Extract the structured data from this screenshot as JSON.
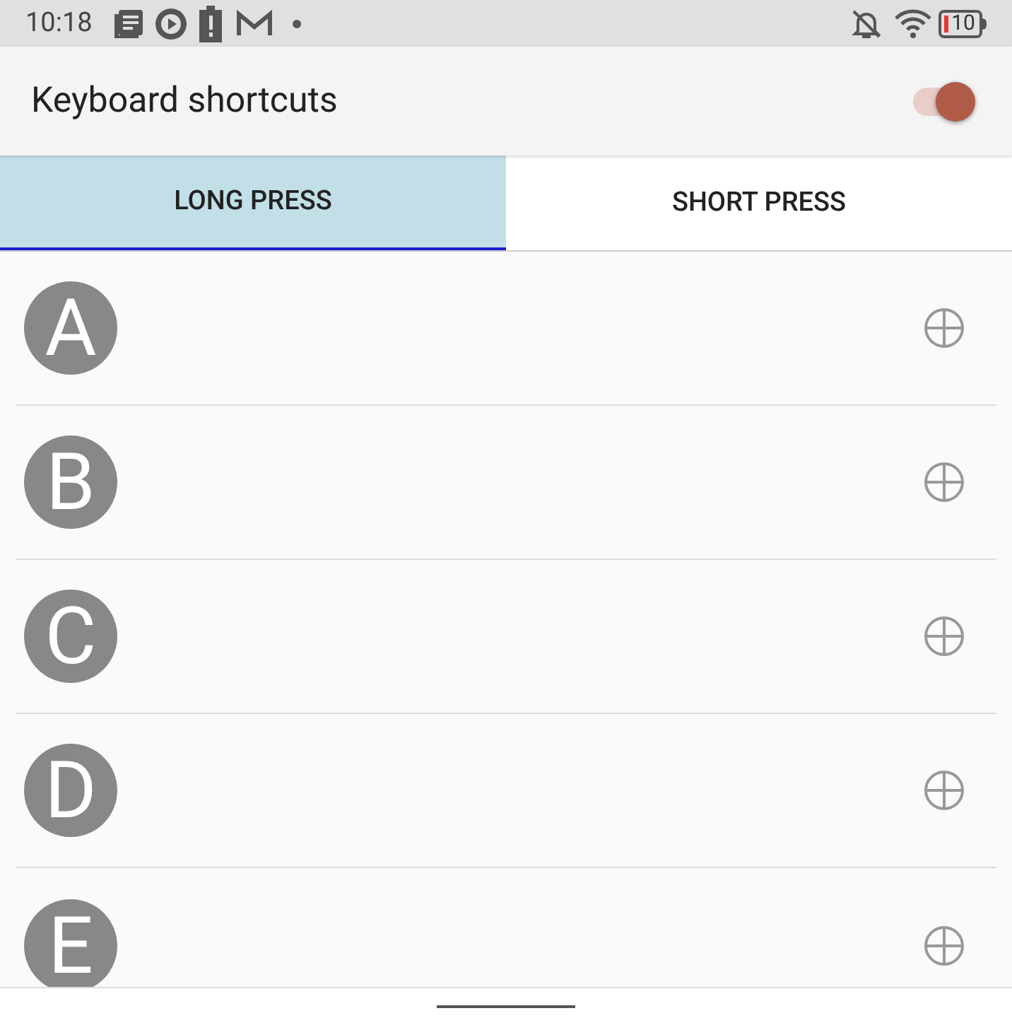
{
  "status_bar": {
    "time": "10:18",
    "battery": "10"
  },
  "app_bar": {
    "title": "Keyboard shortcuts",
    "toggle": {
      "on": true
    }
  },
  "tabs": [
    {
      "label": "LONG PRESS",
      "selected": true
    },
    {
      "label": "SHORT PRESS",
      "selected": false
    }
  ],
  "shortcuts": [
    {
      "letter": "A"
    },
    {
      "letter": "B"
    },
    {
      "letter": "C"
    },
    {
      "letter": "D"
    },
    {
      "letter": "E"
    }
  ]
}
